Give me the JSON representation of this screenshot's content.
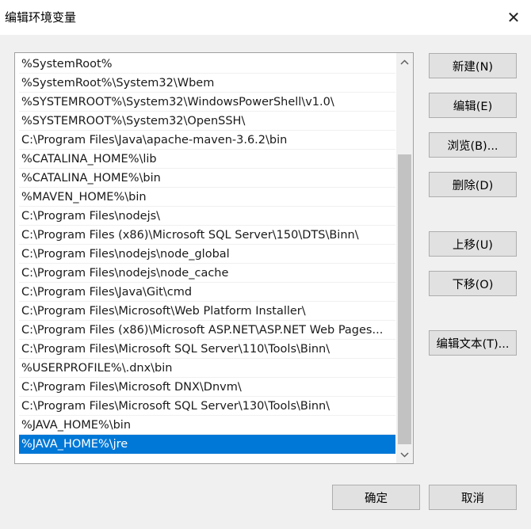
{
  "window": {
    "title": "编辑环境变量",
    "close_label": "✕"
  },
  "list": {
    "items": [
      "%SystemRoot%",
      "%SystemRoot%\\System32\\Wbem",
      "%SYSTEMROOT%\\System32\\WindowsPowerShell\\v1.0\\",
      "%SYSTEMROOT%\\System32\\OpenSSH\\",
      "C:\\Program Files\\Java\\apache-maven-3.6.2\\bin",
      "%CATALINA_HOME%\\lib",
      "%CATALINA_HOME%\\bin",
      "%MAVEN_HOME%\\bin",
      "C:\\Program Files\\nodejs\\",
      "C:\\Program Files (x86)\\Microsoft SQL Server\\150\\DTS\\Binn\\",
      "C:\\Program Files\\nodejs\\node_global",
      "C:\\Program Files\\nodejs\\node_cache",
      "C:\\Program Files\\Java\\Git\\cmd",
      "C:\\Program Files\\Microsoft\\Web Platform Installer\\",
      "C:\\Program Files (x86)\\Microsoft ASP.NET\\ASP.NET Web Pages...",
      "C:\\Program Files\\Microsoft SQL Server\\110\\Tools\\Binn\\",
      "%USERPROFILE%\\.dnx\\bin",
      "C:\\Program Files\\Microsoft DNX\\Dnvm\\",
      "C:\\Program Files\\Microsoft SQL Server\\130\\Tools\\Binn\\",
      "%JAVA_HOME%\\bin",
      "%JAVA_HOME%\\jre"
    ],
    "selected_index": 20
  },
  "buttons": {
    "new": "新建(N)",
    "edit": "编辑(E)",
    "browse": "浏览(B)...",
    "delete": "删除(D)",
    "move_up": "上移(U)",
    "move_down": "下移(O)",
    "edit_text": "编辑文本(T)...",
    "ok": "确定",
    "cancel": "取消"
  },
  "colors": {
    "selection": "#0078d7",
    "button_face": "#e1e1e1",
    "dialog_bg": "#f0f0f0"
  },
  "icons": {
    "close": "close-icon",
    "scroll_up": "chevron-up-icon",
    "scroll_down": "chevron-down-icon"
  }
}
